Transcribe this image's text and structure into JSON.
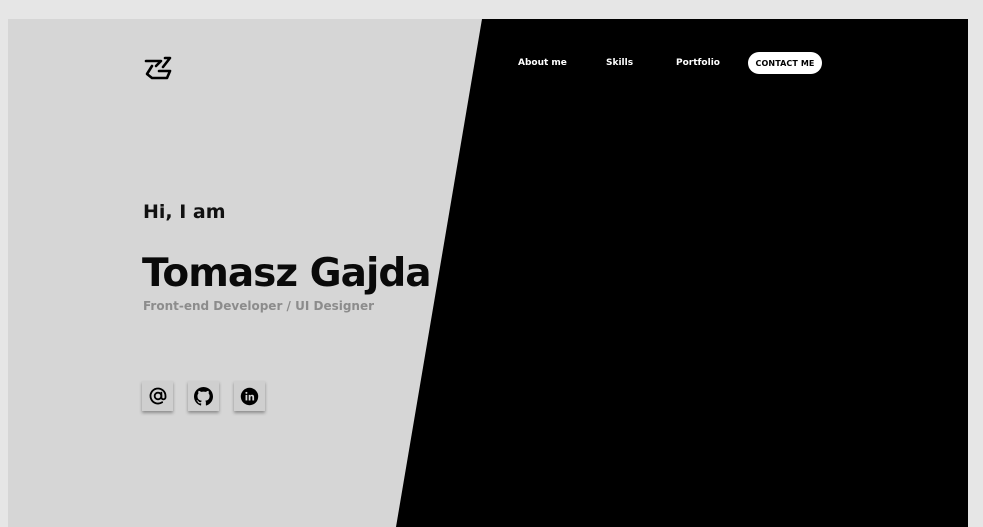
{
  "nav": {
    "items": [
      {
        "label": "About me"
      },
      {
        "label": "Skills"
      },
      {
        "label": "Portfolio"
      }
    ],
    "contact_label": "CONTACT ME"
  },
  "hero": {
    "greeting": "Hi, I am",
    "name": "Tomasz Gajda",
    "role": "Front-end Developer / UI Designer"
  },
  "social": [
    {
      "icon": "at-sign-icon"
    },
    {
      "icon": "github-icon"
    },
    {
      "icon": "linkedin-icon"
    }
  ],
  "colors": {
    "background": "#d6d6d6",
    "panel": "#000000",
    "accent_button": "#ffffff",
    "muted_text": "#8c8c8c"
  }
}
